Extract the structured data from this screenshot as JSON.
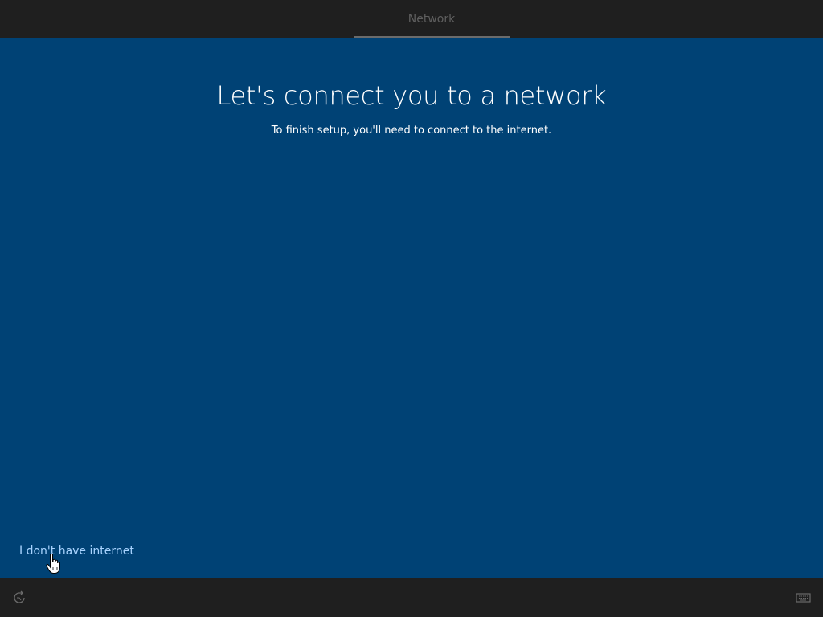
{
  "header": {
    "tab_label": "Network"
  },
  "main": {
    "title": "Let's connect you to a network",
    "subtitle": "To finish setup, you'll need to connect to the internet."
  },
  "footer_link": {
    "label": "I don't have internet"
  },
  "bottom_bar": {
    "left_icon": "ease-of-access-icon",
    "right_icon": "keyboard-icon"
  },
  "colors": {
    "background": "#004275",
    "bars": "#1f1f1f",
    "link": "#a9d4ff"
  }
}
